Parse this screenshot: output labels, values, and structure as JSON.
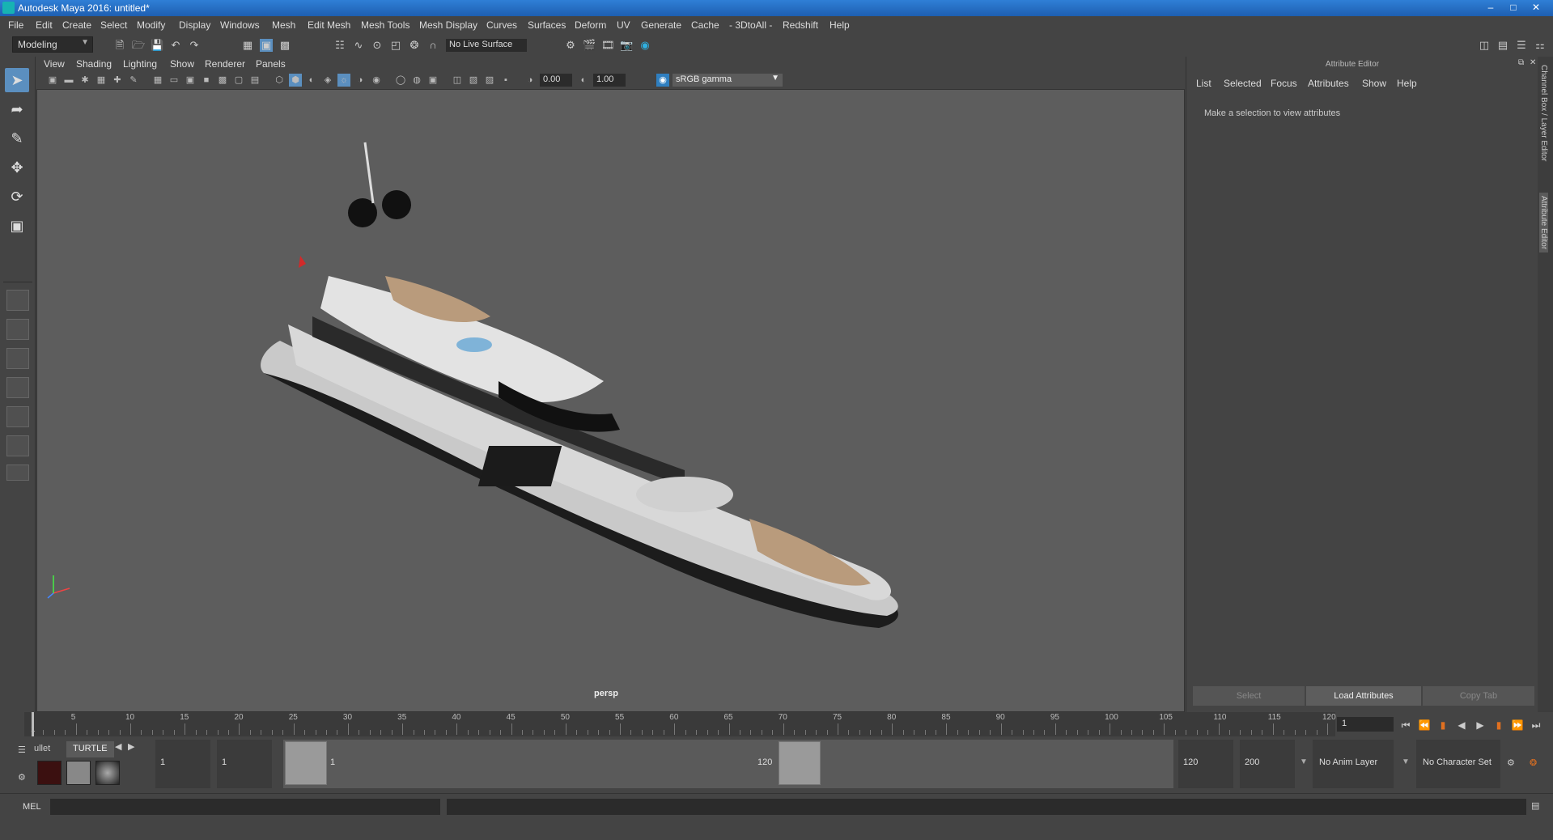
{
  "window": {
    "title": "Autodesk Maya 2016: untitled*",
    "min_icon": "minimize-icon",
    "max_icon": "maximize-icon",
    "close_icon": "close-icon"
  },
  "menubar": {
    "items": [
      "File",
      "Edit",
      "Create",
      "Select",
      "Modify",
      "Display",
      "Windows",
      "Mesh",
      "Edit Mesh",
      "Mesh Tools",
      "Mesh Display",
      "Curves",
      "Surfaces",
      "Deform",
      "UV",
      "Generate",
      "Cache",
      "- 3DtoAll -",
      "Redshift",
      "Help"
    ]
  },
  "statusline": {
    "mode": "Modeling",
    "live_surface": "No Live Surface"
  },
  "panel": {
    "menu": [
      "View",
      "Shading",
      "Lighting",
      "Show",
      "Renderer",
      "Panels"
    ],
    "exposure": "0.00",
    "gamma": "1.00",
    "color_space": "sRGB gamma",
    "camera": "persp"
  },
  "attribute_editor": {
    "title": "Attribute Editor",
    "menu": [
      "List",
      "Selected",
      "Focus",
      "Attributes",
      "Show",
      "Help"
    ],
    "message": "Make a selection to view attributes",
    "buttons": {
      "select": "Select",
      "load": "Load Attributes",
      "copy": "Copy Tab"
    },
    "side_tabs": {
      "channel_box": "Channel Box / Layer Editor",
      "attribute": "Attribute Editor"
    }
  },
  "timeline": {
    "ticks": [
      "5",
      "10",
      "15",
      "20",
      "25",
      "30",
      "35",
      "40",
      "45",
      "50",
      "55",
      "60",
      "65",
      "70",
      "75",
      "80",
      "85",
      "90",
      "95",
      "100",
      "105",
      "110",
      "115",
      "120"
    ],
    "start_mark": "1",
    "current_frame": "1"
  },
  "range": {
    "shelf_tabs": [
      "ullet",
      "TURTLE"
    ],
    "start_anim": "1",
    "start_play": "1",
    "handle_start": "1",
    "handle_end": "120",
    "end_play": "120",
    "end_anim": "200",
    "anim_layer": "No Anim Layer",
    "character_set": "No Character Set"
  },
  "cmdline": {
    "language": "MEL"
  }
}
